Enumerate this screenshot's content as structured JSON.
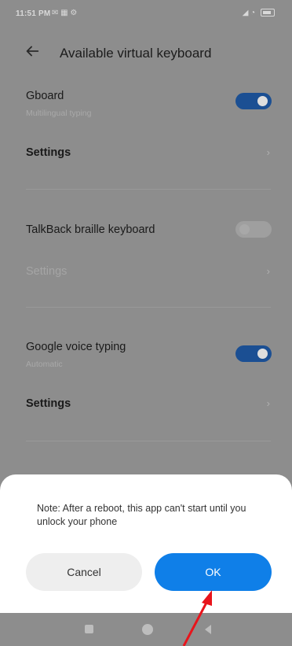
{
  "status_bar": {
    "time": "11:51 PM",
    "left_icons": "✉ ▦ ⚙",
    "right_icons": "◢ ◔"
  },
  "header": {
    "title": "Available virtual keyboard",
    "back_icon": "arrow-left-icon"
  },
  "keyboards": [
    {
      "name": "Gboard",
      "subtitle": "Multilingual typing",
      "enabled": true,
      "settings_label": "Settings",
      "settings_enabled": true
    },
    {
      "name": "TalkBack braille keyboard",
      "subtitle": "",
      "enabled": false,
      "settings_label": "Settings",
      "settings_enabled": false
    },
    {
      "name": "Google voice typing",
      "subtitle": "Automatic",
      "enabled": true,
      "settings_label": "Settings",
      "settings_enabled": true
    }
  ],
  "chevron": "›",
  "dialog": {
    "note": "Note: After a reboot, this app can't start until you unlock your phone",
    "cancel_label": "Cancel",
    "ok_label": "OK"
  },
  "colors": {
    "accent": "#0f7fe8",
    "toggle_on": "#1b4f93",
    "annotation_arrow": "#e8141b"
  }
}
